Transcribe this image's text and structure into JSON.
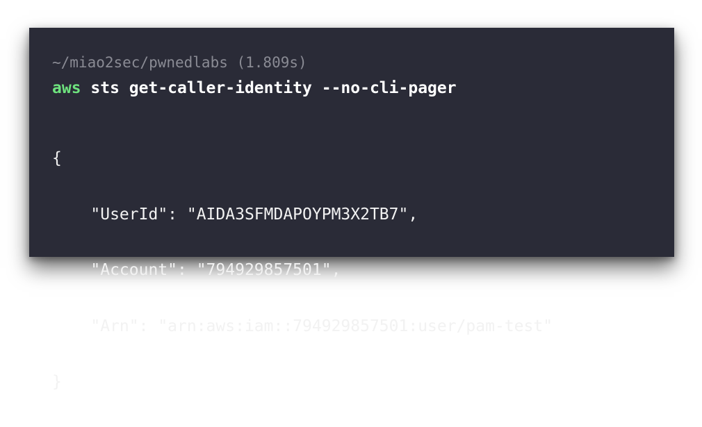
{
  "terminal": {
    "prompt_path": "~/miao2sec/pwnedlabs (1.809s)",
    "command": {
      "name": "aws",
      "args": " sts get-caller-identity --no-cli-pager"
    },
    "output": {
      "open_brace": "{",
      "lines": [
        "    \"UserId\": \"AIDA3SFMDAPOYPM3X2TB7\",",
        "    \"Account\": \"794929857501\",",
        "    \"Arn\": \"arn:aws:iam::794929857501:user/pam-test\""
      ],
      "close_brace": "}"
    }
  },
  "colors": {
    "background": "#2a2b37",
    "prompt": "#8a8b94",
    "command_name": "#6ee37e",
    "text": "#f2f2f2"
  }
}
